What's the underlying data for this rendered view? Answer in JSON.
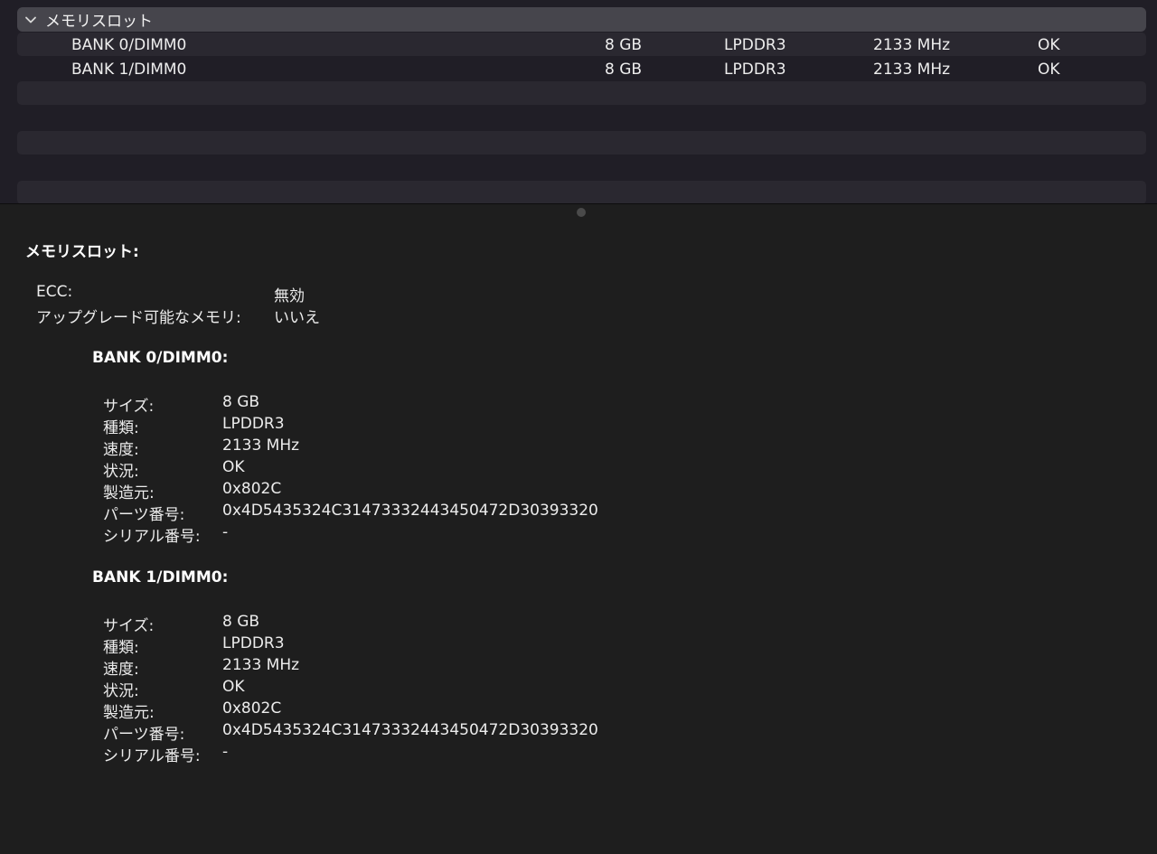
{
  "list": {
    "group_label": "メモリスロット",
    "rows": [
      {
        "name": "BANK 0/DIMM0",
        "size": "8 GB",
        "type": "LPDDR3",
        "speed": "2133 MHz",
        "status": "OK"
      },
      {
        "name": "BANK 1/DIMM0",
        "size": "8 GB",
        "type": "LPDDR3",
        "speed": "2133 MHz",
        "status": "OK"
      }
    ]
  },
  "detail": {
    "title": "メモリスロット:",
    "summary": [
      {
        "key": "ECC:",
        "value": "無効"
      },
      {
        "key": "アップグレード可能なメモリ:",
        "value": "いいえ"
      }
    ],
    "banks": [
      {
        "title": "BANK 0/DIMM0:",
        "fields": [
          {
            "key": "サイズ:",
            "value": "8 GB"
          },
          {
            "key": "種類:",
            "value": "LPDDR3"
          },
          {
            "key": "速度:",
            "value": "2133 MHz"
          },
          {
            "key": "状況:",
            "value": "OK"
          },
          {
            "key": "製造元:",
            "value": "0x802C"
          },
          {
            "key": "パーツ番号:",
            "value": "0x4D5435324C3147333244345047​2D30393320"
          },
          {
            "key": "シリアル番号:",
            "value": "-"
          }
        ]
      },
      {
        "title": "BANK 1/DIMM0:",
        "fields": [
          {
            "key": "サイズ:",
            "value": "8 GB"
          },
          {
            "key": "種類:",
            "value": "LPDDR3"
          },
          {
            "key": "速度:",
            "value": "2133 MHz"
          },
          {
            "key": "状況:",
            "value": "OK"
          },
          {
            "key": "製造元:",
            "value": "0x802C"
          },
          {
            "key": "パーツ番号:",
            "value": "0x4D5435324C3147333244345047​2D30393320"
          },
          {
            "key": "シリアル番号:",
            "value": "-"
          }
        ]
      }
    ]
  }
}
